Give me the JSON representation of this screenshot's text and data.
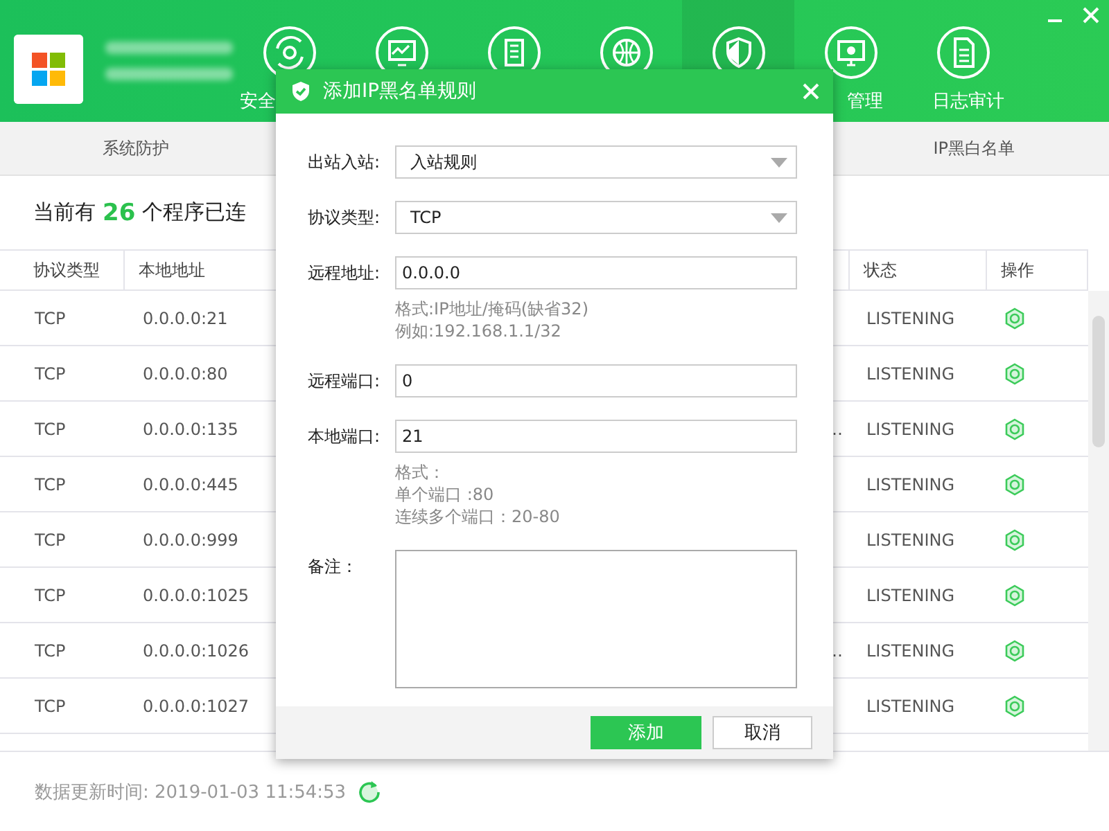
{
  "nav": [
    {
      "label": "安全",
      "kind": "cut_end",
      "selected": false
    },
    {
      "selected": false
    },
    {
      "selected": false
    },
    {
      "selected": false
    },
    {
      "selected": true
    },
    {
      "label": "管理",
      "kind": "cut_start",
      "selected": false
    },
    {
      "label": "日志审计",
      "selected": false
    }
  ],
  "subtabs": [
    {
      "label": "系统防护",
      "selected": false
    },
    {
      "label": "IP黑白名单",
      "selected": false
    }
  ],
  "summary": {
    "prefix": "当前有",
    "count": "26",
    "suffix": "个程序已连"
  },
  "table": {
    "columns": [
      "协议类型",
      "本地地址",
      "状态",
      "操作"
    ],
    "rows": [
      {
        "protocol": "TCP",
        "local_address": "0.0.0.0:21",
        "status": "LISTENING"
      },
      {
        "protocol": "TCP",
        "local_address": "0.0.0.0:80",
        "status": "LISTENING"
      },
      {
        "protocol": "TCP",
        "local_address": "0.0.0.0:135",
        "column_3": "…",
        "status": "LISTENING"
      },
      {
        "protocol": "TCP",
        "local_address": "0.0.0.0:445",
        "status": "LISTENING"
      },
      {
        "protocol": "TCP",
        "local_address": "0.0.0.0:999",
        "status": "LISTENING"
      },
      {
        "protocol": "TCP",
        "local_address": "0.0.0.0:1025",
        "status": "LISTENING"
      },
      {
        "protocol": "TCP",
        "local_address": "0.0.0.0:1026",
        "column_3": "…",
        "status": "LISTENING"
      },
      {
        "protocol": "TCP",
        "local_address": "0.0.0.0:1027",
        "status": "LISTENING"
      }
    ]
  },
  "footer": {
    "updated": "数据更新时间: 2019-01-03 11:54:53"
  },
  "dialog": {
    "title": "添加IP黑名单规则",
    "fields": [
      {
        "kind": "select",
        "label": "出站入站:",
        "value": "入站规则"
      },
      {
        "kind": "select",
        "label": "协议类型:",
        "value": "TCP"
      },
      {
        "kind": "text",
        "label": "远程地址:",
        "value": "0.0.0.0",
        "hints": [
          "格式:IP地址/掩码(缺省32)",
          "例如:192.168.1.1/32"
        ]
      },
      {
        "kind": "text",
        "label": "远程端口:",
        "value": "0"
      },
      {
        "kind": "text",
        "label": "本地端口:",
        "value": "21",
        "hints": [
          "格式：",
          "单个端口 :80",
          "连续多个端口：20-80"
        ]
      },
      {
        "kind": "textarea",
        "label": "备注："
      }
    ],
    "buttons": [
      {
        "label": "添加",
        "kind": "primary"
      },
      {
        "label": "取消",
        "kind": "secondary"
      }
    ]
  }
}
